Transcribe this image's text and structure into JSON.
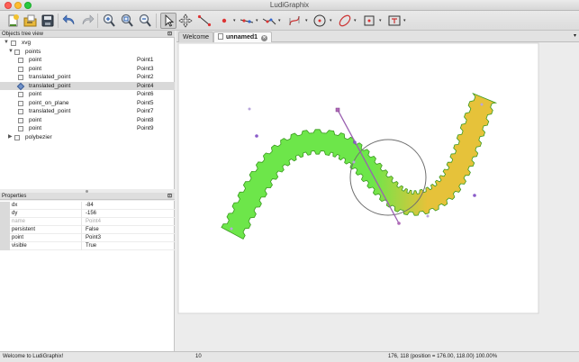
{
  "window": {
    "title": "LudiGraphix"
  },
  "toolbar": {
    "tools": [
      "new-document-icon",
      "open-file-icon",
      "save-icon",
      "undo-icon",
      "redo-icon",
      "zoom-in-icon",
      "zoom-fit-icon",
      "zoom-out-icon",
      "select-arrow-icon",
      "move-icon",
      "segment-tool-icon",
      "point-tool-icon",
      "line-tool-icon",
      "polyline-tool-icon",
      "bezier-tool-icon",
      "circle-tool-icon",
      "ellipse-tool-icon",
      "rectangle-tool-icon",
      "text-frame-tool-icon"
    ]
  },
  "objects_tree": {
    "title": "Objects tree view",
    "rows": [
      {
        "label": "xvg",
        "value": ""
      },
      {
        "label": "points",
        "value": ""
      },
      {
        "label": "point",
        "value": "Point1"
      },
      {
        "label": "point",
        "value": "Point3"
      },
      {
        "label": "translated_point",
        "value": "Point2"
      },
      {
        "label": "translated_point",
        "value": "Point4"
      },
      {
        "label": "point",
        "value": "Point6"
      },
      {
        "label": "point_on_plane",
        "value": "Point5"
      },
      {
        "label": "translated_point",
        "value": "Point7"
      },
      {
        "label": "point",
        "value": "Point8"
      },
      {
        "label": "point",
        "value": "Point9"
      },
      {
        "label": "polybezier",
        "value": ""
      }
    ]
  },
  "properties": {
    "title": "Properties",
    "rows": [
      {
        "key": "dx",
        "value": "-84"
      },
      {
        "key": "dy",
        "value": "-156"
      },
      {
        "key": "name",
        "value": "Point4"
      },
      {
        "key": "persistent",
        "value": "False"
      },
      {
        "key": "point",
        "value": "Point3"
      },
      {
        "key": "visible",
        "value": "True"
      }
    ]
  },
  "tabs": [
    {
      "label": "Welcome"
    },
    {
      "label": "unnamed1"
    }
  ],
  "status": {
    "message": "Welcome to LudiGraphix!",
    "count": "10",
    "position": "176, 118 (position = 176.00, 118.00) 100.00%"
  },
  "colors": {
    "shape_green": "#6de64a",
    "shape_yellow": "#e6c23a",
    "outline_green": "#3a9a1f",
    "point_purple": "#8a5cc9",
    "selected_point": "#b06ab8",
    "segment_purple": "#9a60b0",
    "circle_gray": "#6f6f6f"
  }
}
